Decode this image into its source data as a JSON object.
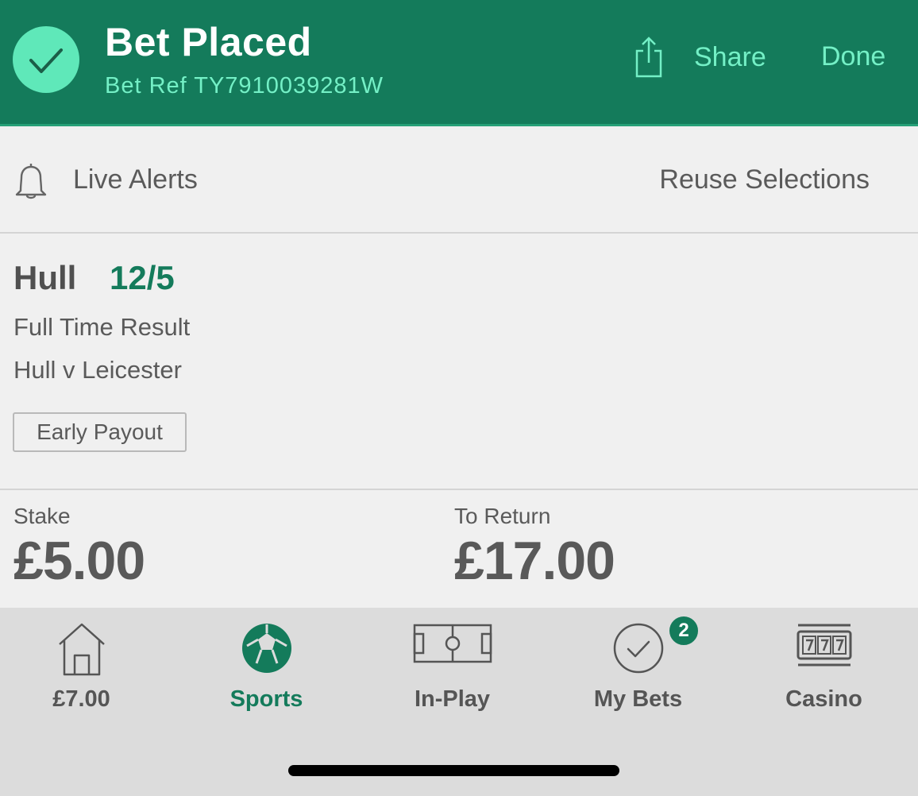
{
  "header": {
    "title": "Bet Placed",
    "bet_ref": "Bet Ref TY7910039281W",
    "share_label": "Share",
    "done_label": "Done",
    "icons": [
      "checkmark-icon",
      "share-icon"
    ]
  },
  "actions": {
    "live_alerts_label": "Live Alerts",
    "reuse_label": "Reuse Selections"
  },
  "selection": {
    "name": "Hull",
    "odds": "12/5",
    "market": "Full Time Result",
    "event": "Hull v Leicester",
    "badge": "Early Payout"
  },
  "bet": {
    "stake_label": "Stake",
    "stake_value": "£5.00",
    "return_label": "To Return",
    "return_value": "£17.00"
  },
  "tabbar": {
    "tabs": [
      {
        "label": "£7.00",
        "icon": "home-icon"
      },
      {
        "label": "Sports",
        "icon": "football-icon",
        "active": true
      },
      {
        "label": "In-Play",
        "icon": "pitch-icon"
      },
      {
        "label": "My Bets",
        "icon": "check-circle-icon",
        "badge": "2"
      },
      {
        "label": "Casino",
        "icon": "slot-machine-icon"
      }
    ]
  },
  "colors": {
    "header_bg": "#147b5b",
    "accent": "#74f0c6",
    "odds_green": "#147b5b"
  }
}
